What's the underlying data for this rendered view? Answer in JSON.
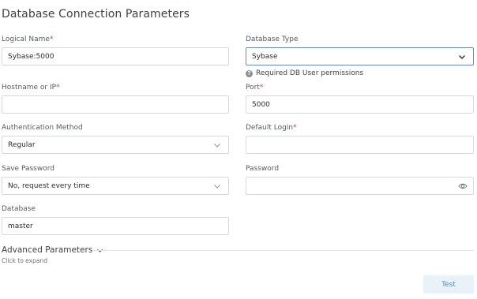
{
  "page": {
    "title": "Database Connection Parameters"
  },
  "form": {
    "logical_name": {
      "label": "Logical Name",
      "required_mark": "*",
      "value": "Sybase:5000"
    },
    "database_type": {
      "label": "Database Type",
      "value": "Sybase",
      "help": "Required DB User permissions",
      "help_icon": "?"
    },
    "hostname": {
      "label": "Hostname or IP",
      "required_mark": "*",
      "value": ""
    },
    "port": {
      "label": "Port",
      "required_mark": "*",
      "value": "5000"
    },
    "auth_method": {
      "label": "Authentication Method",
      "value": "Regular"
    },
    "default_login": {
      "label": "Default Login",
      "required_mark": "*",
      "value": ""
    },
    "save_password": {
      "label": "Save Password",
      "value": "No, request every time"
    },
    "password": {
      "label": "Password",
      "value": ""
    },
    "database": {
      "label": "Database",
      "value": "master"
    }
  },
  "advanced": {
    "title": "Advanced Parameters",
    "subtitle": "Click to expand"
  },
  "actions": {
    "test_label": "Test"
  },
  "colors": {
    "accent": "#4b8fd6",
    "required": "#e0383e",
    "button_bg": "#e9f1f9",
    "button_text": "#5b8ac4"
  }
}
